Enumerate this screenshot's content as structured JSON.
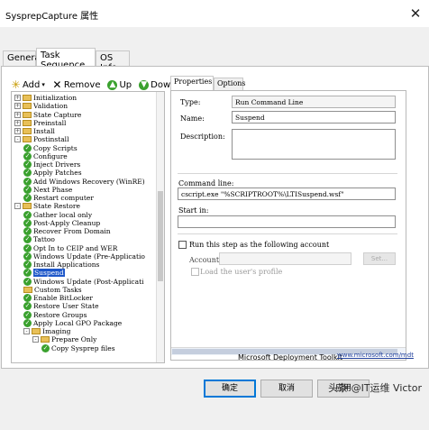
{
  "window": {
    "title": "SysprepCapture 属性",
    "close_glyph": "✕"
  },
  "tabs": [
    {
      "label": "General",
      "active": false
    },
    {
      "label": "Task Sequence",
      "active": true
    },
    {
      "label": "OS Info",
      "active": false
    }
  ],
  "toolbar": {
    "add": "Add",
    "remove": "Remove",
    "up": "Up",
    "down": "Down",
    "icons": {
      "add": "add-icon",
      "remove": "remove-icon",
      "up": "up-arrow-icon",
      "down": "down-arrow-icon"
    }
  },
  "tree": {
    "items": [
      {
        "label": "Initialization",
        "type": "folder",
        "expander": "+",
        "level": 0
      },
      {
        "label": "Validation",
        "type": "folder",
        "expander": "+",
        "level": 0
      },
      {
        "label": "State Capture",
        "type": "folder",
        "expander": "+",
        "level": 0
      },
      {
        "label": "Preinstall",
        "type": "folder",
        "expander": "+",
        "level": 0
      },
      {
        "label": "Install",
        "type": "folder",
        "expander": "+",
        "level": 0
      },
      {
        "label": "Postinstall",
        "type": "folder",
        "expander": "-",
        "level": 0
      },
      {
        "label": "Copy Scripts",
        "type": "check",
        "level": 1
      },
      {
        "label": "Configure",
        "type": "check",
        "level": 1
      },
      {
        "label": "Inject Drivers",
        "type": "check",
        "level": 1
      },
      {
        "label": "Apply Patches",
        "type": "check",
        "level": 1
      },
      {
        "label": "Add Windows Recovery (WinRE)",
        "type": "check",
        "level": 1
      },
      {
        "label": "Next Phase",
        "type": "check",
        "level": 1
      },
      {
        "label": "Restart computer",
        "type": "check",
        "level": 1
      },
      {
        "label": "State Restore",
        "type": "folder",
        "expander": "-",
        "level": 0
      },
      {
        "label": "Gather local only",
        "type": "check",
        "level": 1
      },
      {
        "label": "Post-Apply Cleanup",
        "type": "check",
        "level": 1
      },
      {
        "label": "Recover From Domain",
        "type": "check",
        "level": 1
      },
      {
        "label": "Tattoo",
        "type": "check",
        "level": 1
      },
      {
        "label": "Opt In to CEIP and WER",
        "type": "check",
        "level": 1
      },
      {
        "label": "Windows Update (Pre-Applicatio",
        "type": "check",
        "level": 1
      },
      {
        "label": "Install Applications",
        "type": "check",
        "level": 1
      },
      {
        "label": "Suspend",
        "type": "check",
        "level": 1,
        "selected": true
      },
      {
        "label": "Windows Update (Post-Applicati",
        "type": "check",
        "level": 1
      },
      {
        "label": "Custom Tasks",
        "type": "folder",
        "level": 1
      },
      {
        "label": "Enable BitLocker",
        "type": "check",
        "level": 1
      },
      {
        "label": "Restore User State",
        "type": "check",
        "level": 1
      },
      {
        "label": "Restore Groups",
        "type": "check",
        "level": 1
      },
      {
        "label": "Apply Local GPO Package",
        "type": "check",
        "level": 1
      },
      {
        "label": "Imaging",
        "type": "folder",
        "expander": "-",
        "level": 1
      },
      {
        "label": "Prepare Only",
        "type": "folder",
        "expander": "-",
        "level": 2
      },
      {
        "label": "Copy Sysprep files",
        "type": "check",
        "level": 3
      }
    ]
  },
  "properties_tabs": [
    {
      "label": "Properties",
      "active": true
    },
    {
      "label": "Options",
      "active": false
    }
  ],
  "properties": {
    "type_label": "Type:",
    "type_value": "Run Command Line",
    "name_label": "Name:",
    "name_value": "Suspend",
    "description_label": "Description:",
    "description_value": "",
    "command_label": "Command line:",
    "command_value": "cscript.exe \"%SCRIPTROOT%\\LTISuspend.wsf\"",
    "start_label": "Start in:",
    "start_value": "",
    "run_as_label": "Run this step as the following account",
    "account_label": "Account:",
    "account_value": "",
    "set_button": "Set...",
    "load_profile_label": "Load the user's profile"
  },
  "footer": {
    "brand": "Microsoft Deployment Toolkit",
    "link": "www.microsoft.com/mdt"
  },
  "buttons": {
    "ok": "确定",
    "cancel": "取消",
    "apply": "应用"
  },
  "watermark": "头条 @IT运维 Victor",
  "colors": {
    "selection": "#1e57c9",
    "check": "#3aa12e",
    "link": "#1f3f9c",
    "folder": "#e8c058"
  }
}
